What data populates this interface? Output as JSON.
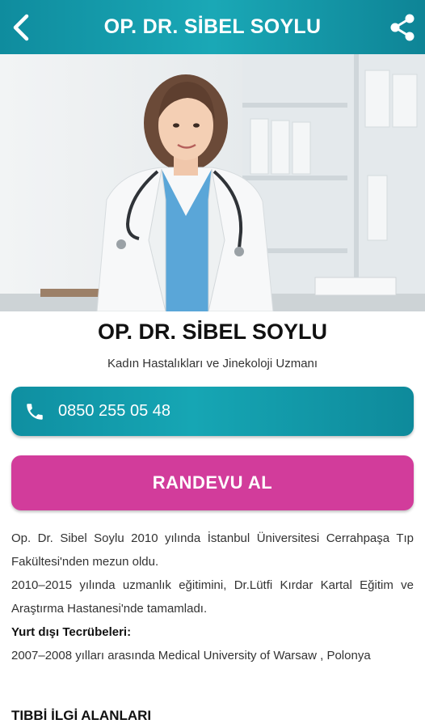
{
  "header": {
    "title": "OP. DR. SİBEL SOYLU",
    "back_icon": "chevron-left-icon",
    "share_icon": "share-icon"
  },
  "doctor": {
    "name": "OP. DR. SİBEL SOYLU",
    "specialty": "Kadın Hastalıkları ve Jinekoloji Uzmanı"
  },
  "phone": {
    "icon": "phone-icon",
    "number": "0850 255 05 48"
  },
  "appointment": {
    "label": "RANDEVU AL"
  },
  "bio": {
    "p1": "Op. Dr. Sibel Soylu 2010 yılında İstanbul Üniversitesi Cerrahpaşa Tıp Fakültesi'nden mezun oldu.",
    "p2": "2010–2015 yılında uzmanlık eğitimini, Dr.Lütfi Kırdar Kartal Eğitim ve Araştırma Hastanesi'nde tamamladı.",
    "abroad_heading": "Yurt dışı Tecrübeleri:",
    "p3": "2007–2008 yılları arasında Medical University of Warsaw , Polonya"
  },
  "section_heading": "TIBBİ İLGİ ALANLARI",
  "colors": {
    "header": "#1aa8b6",
    "phone_button": "#16a6b4",
    "appointment_button": "#d23c9b"
  }
}
